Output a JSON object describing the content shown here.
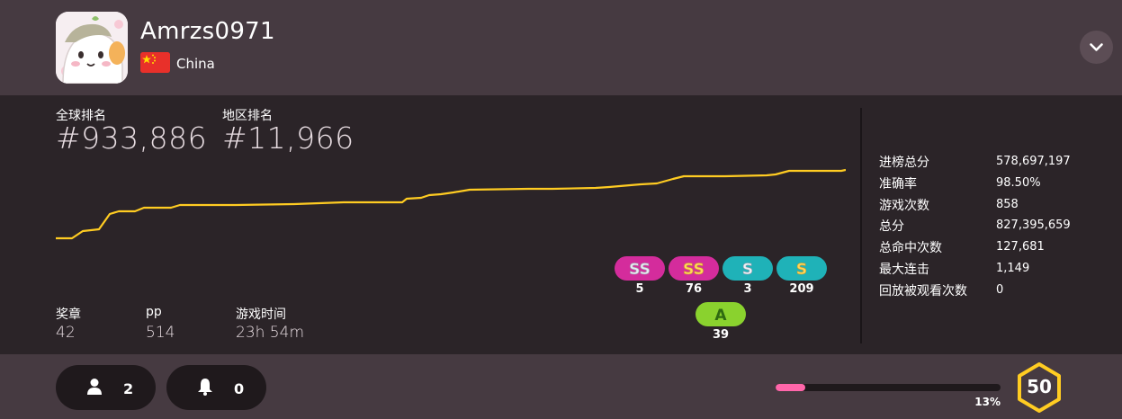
{
  "profile": {
    "username": "Amrzs0971",
    "country": "China",
    "avatar_icon": "anime-cat-avatar",
    "flag_icon": "china-flag-icon"
  },
  "ranks": {
    "global_label": "全球排名",
    "global_value": "#933,886",
    "country_label": "地区排名",
    "country_value": "#11,966"
  },
  "rank_history": {
    "line_color": "#ffcc22"
  },
  "grades": [
    {
      "grade": "SS",
      "variant": "silver",
      "count": "5",
      "color": "#d42c9c"
    },
    {
      "grade": "SS",
      "variant": "gold",
      "count": "76",
      "color": "#d42c9c"
    },
    {
      "grade": "S",
      "variant": "silver",
      "count": "3",
      "color": "#1fb2b8"
    },
    {
      "grade": "S",
      "variant": "gold",
      "count": "209",
      "color": "#1fb2b8"
    },
    {
      "grade": "A",
      "variant": "normal",
      "count": "39",
      "color": "#8ad22e"
    }
  ],
  "small_stats": [
    {
      "label": "奖章",
      "value": "42"
    },
    {
      "label": "pp",
      "value": "514"
    },
    {
      "label": "游戏时间",
      "value": "23h 54m"
    }
  ],
  "stats": [
    {
      "label": "进榜总分",
      "value": "578,697,197"
    },
    {
      "label": "准确率",
      "value": "98.50%"
    },
    {
      "label": "游戏次数",
      "value": "858"
    },
    {
      "label": "总分",
      "value": "827,395,659"
    },
    {
      "label": "总命中次数",
      "value": "127,681"
    },
    {
      "label": "最大连击",
      "value": "1,149"
    },
    {
      "label": "回放被观看次数",
      "value": "0"
    }
  ],
  "footer": {
    "followers": "2",
    "notifications": "0",
    "level_progress_text": "13%",
    "level_progress": 0.13,
    "level": "50",
    "accent_color": "#ff66aa",
    "level_color": "#ffcc22"
  }
}
